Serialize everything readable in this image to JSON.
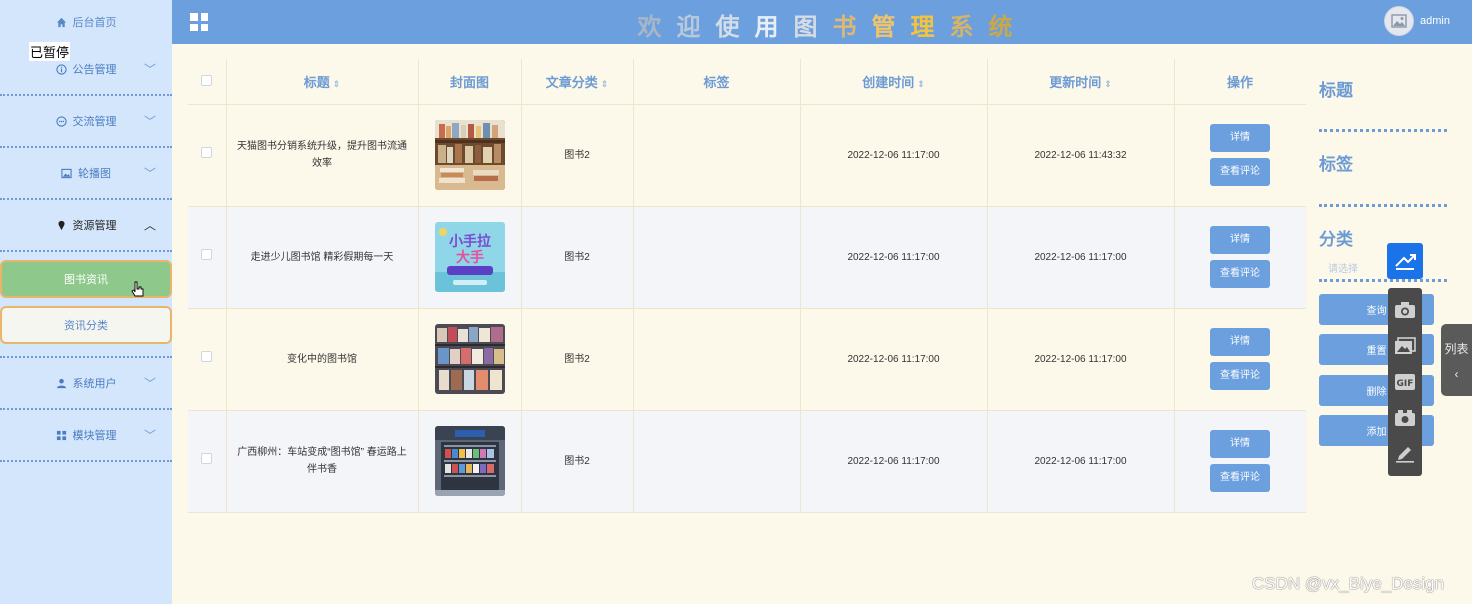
{
  "header": {
    "title_chars": [
      {
        "ch": "欢",
        "color": "#a8b6c8"
      },
      {
        "ch": "迎",
        "color": "#b9c9dc"
      },
      {
        "ch": "使",
        "color": "#d2dde8"
      },
      {
        "ch": "用",
        "color": "#e8eef6"
      },
      {
        "ch": "图",
        "color": "#d6dce4"
      },
      {
        "ch": "书",
        "color": "#e0b873"
      },
      {
        "ch": "管",
        "color": "#f1c46a"
      },
      {
        "ch": "理",
        "color": "#f5c33c"
      },
      {
        "ch": "系",
        "color": "#d4b36a"
      },
      {
        "ch": "统",
        "color": "#c9a84a"
      }
    ],
    "username": "admin"
  },
  "sidebar": {
    "home": "后台首页",
    "overlay": "已暂停",
    "menus": [
      {
        "label": "公告管理",
        "icon": "info-circle-icon",
        "expanded": false
      },
      {
        "label": "交流管理",
        "icon": "chat-icon",
        "expanded": false
      },
      {
        "label": "轮播图",
        "icon": "picture-icon",
        "expanded": false
      },
      {
        "label": "资源管理",
        "icon": "location-pin-icon",
        "expanded": true
      },
      {
        "label": "系统用户",
        "icon": "user-icon",
        "expanded": false
      },
      {
        "label": "模块管理",
        "icon": "grid-icon",
        "expanded": false
      }
    ],
    "submenu": [
      {
        "label": "图书资讯",
        "active": true
      },
      {
        "label": "资讯分类",
        "active": false
      }
    ]
  },
  "table": {
    "columns": [
      "标题",
      "封面图",
      "文章分类",
      "标签",
      "创建时间",
      "更新时间",
      "操作"
    ],
    "rows": [
      {
        "title": "天猫图书分销系统升级，提升图书流通效率",
        "category": "图书2",
        "tag": "",
        "created": "2022-12-06 11:17:00",
        "updated": "2022-12-06 11:43:32",
        "cover": "library-shelves"
      },
      {
        "title": "走进少儿图书馆 精彩假期每一天",
        "category": "图书2",
        "tag": "",
        "created": "2022-12-06 11:17:00",
        "updated": "2022-12-06 11:17:00",
        "cover": "kids-poster"
      },
      {
        "title": "变化中的图书馆",
        "category": "图书2",
        "tag": "",
        "created": "2022-12-06 11:17:00",
        "updated": "2022-12-06 11:17:00",
        "cover": "bookstore"
      },
      {
        "title": "广西柳州：车站变成“图书馆” 春运路上伴书香",
        "category": "图书2",
        "tag": "",
        "created": "2022-12-06 11:17:00",
        "updated": "2022-12-06 11:17:00",
        "cover": "station-shelf"
      }
    ],
    "actions": {
      "detail": "详情",
      "comments": "查看评论"
    }
  },
  "search": {
    "title_label": "标题",
    "tag_label": "标签",
    "category_label": "分类",
    "category_placeholder": "请选择",
    "buttons": {
      "query": "查询",
      "reset": "重置",
      "delete": "删除",
      "add": "添加"
    }
  },
  "floating": {
    "list_tab": "列表"
  },
  "watermark": "CSDN @vx_Biye_Design",
  "colors": {
    "header": "#6b9fdd",
    "sidebar": "#d4e6fb",
    "content_bg": "#fdf9ea",
    "active_submenu": "#8fc88b",
    "accent_text": "#6d9bd4"
  }
}
